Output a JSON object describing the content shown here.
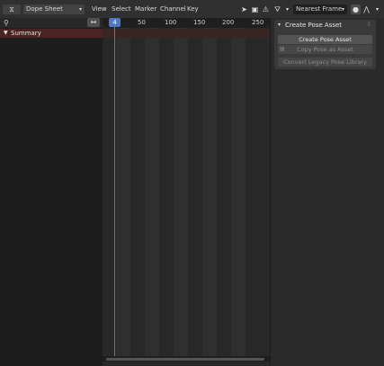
{
  "header": {
    "editor_type_icon": "dope-sheet-editor-icon",
    "mode_label": "Dope Sheet",
    "menus": [
      "View",
      "Select",
      "Marker",
      "Channel",
      "Key"
    ],
    "snap_label": "Nearest Frame"
  },
  "channels": {
    "summary_label": "Summary"
  },
  "timeline": {
    "current_frame": "4",
    "ticks": [
      "50",
      "100",
      "150",
      "200",
      "250"
    ]
  },
  "sidebar": {
    "panel_title": "Create Pose Asset",
    "buttons": {
      "create": "Create Pose Asset",
      "copy": "Copy Pose as Asset",
      "convert": "Convert Legacy Pose Library"
    }
  },
  "colors": {
    "playhead": "#4a79c9",
    "summary_row": "#4a2424"
  }
}
